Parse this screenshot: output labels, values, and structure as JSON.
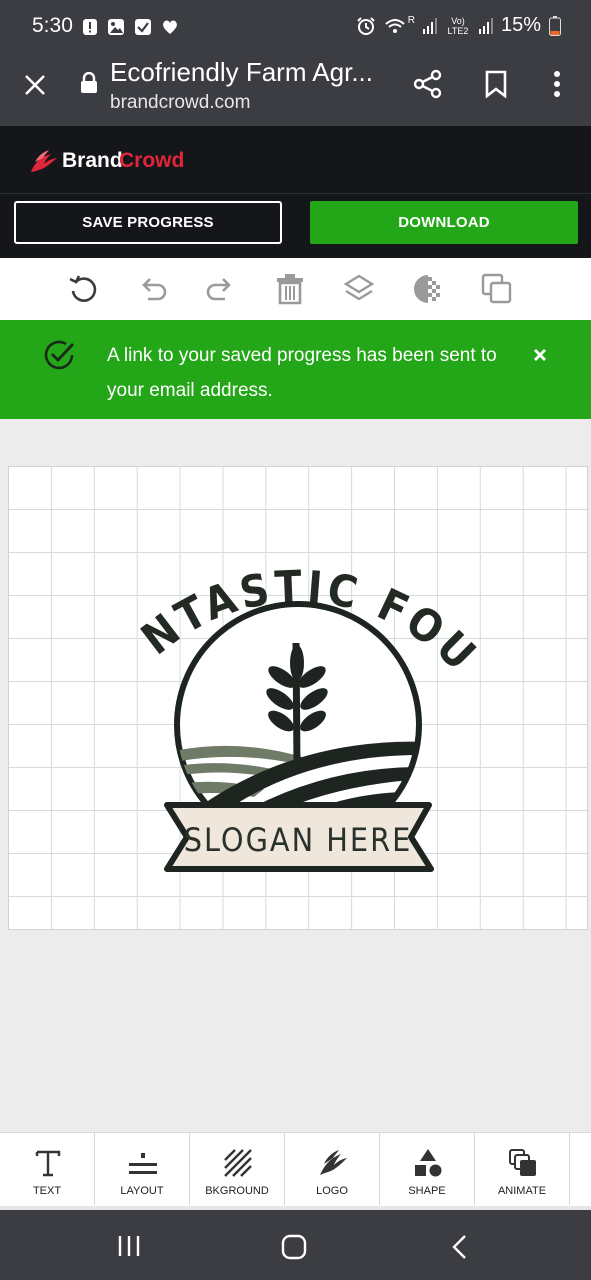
{
  "status_bar": {
    "time": "5:30",
    "network_label": "Vo) LTE2",
    "roaming_label": "R",
    "battery": "15%"
  },
  "browser": {
    "page_title": "Ecofriendly Farm Agr...",
    "domain": "brandcrowd.com"
  },
  "brand": {
    "name_part1": "Brand",
    "name_part2": "Crowd"
  },
  "actions": {
    "save_label": "SAVE PROGRESS",
    "download_label": "DOWNLOAD"
  },
  "toolbar": {
    "icons": [
      "reset-icon",
      "undo-icon",
      "redo-icon",
      "delete-icon",
      "layers-icon",
      "opacity-icon",
      "duplicate-icon"
    ]
  },
  "notice": {
    "message": "A link to your saved progress has been sent to your email address."
  },
  "logo": {
    "arc_text": "FANTASTIC FOUR",
    "slogan": "SLOGAN HERE"
  },
  "bottom_nav": {
    "items": [
      {
        "label": "TEXT",
        "icon": "text-icon"
      },
      {
        "label": "LAYOUT",
        "icon": "layout-icon"
      },
      {
        "label": "BKGROUND",
        "icon": "background-icon"
      },
      {
        "label": "LOGO",
        "icon": "logo-icon"
      },
      {
        "label": "SHAPE",
        "icon": "shape-icon"
      },
      {
        "label": "ANIMATE",
        "icon": "animate-icon"
      }
    ]
  },
  "colors": {
    "accent_green": "#23a618",
    "brand_red": "#e0263b",
    "logo_dark": "#1e2520",
    "logo_olive": "#6f7a67",
    "ribbon_fill": "#efe6dc"
  }
}
